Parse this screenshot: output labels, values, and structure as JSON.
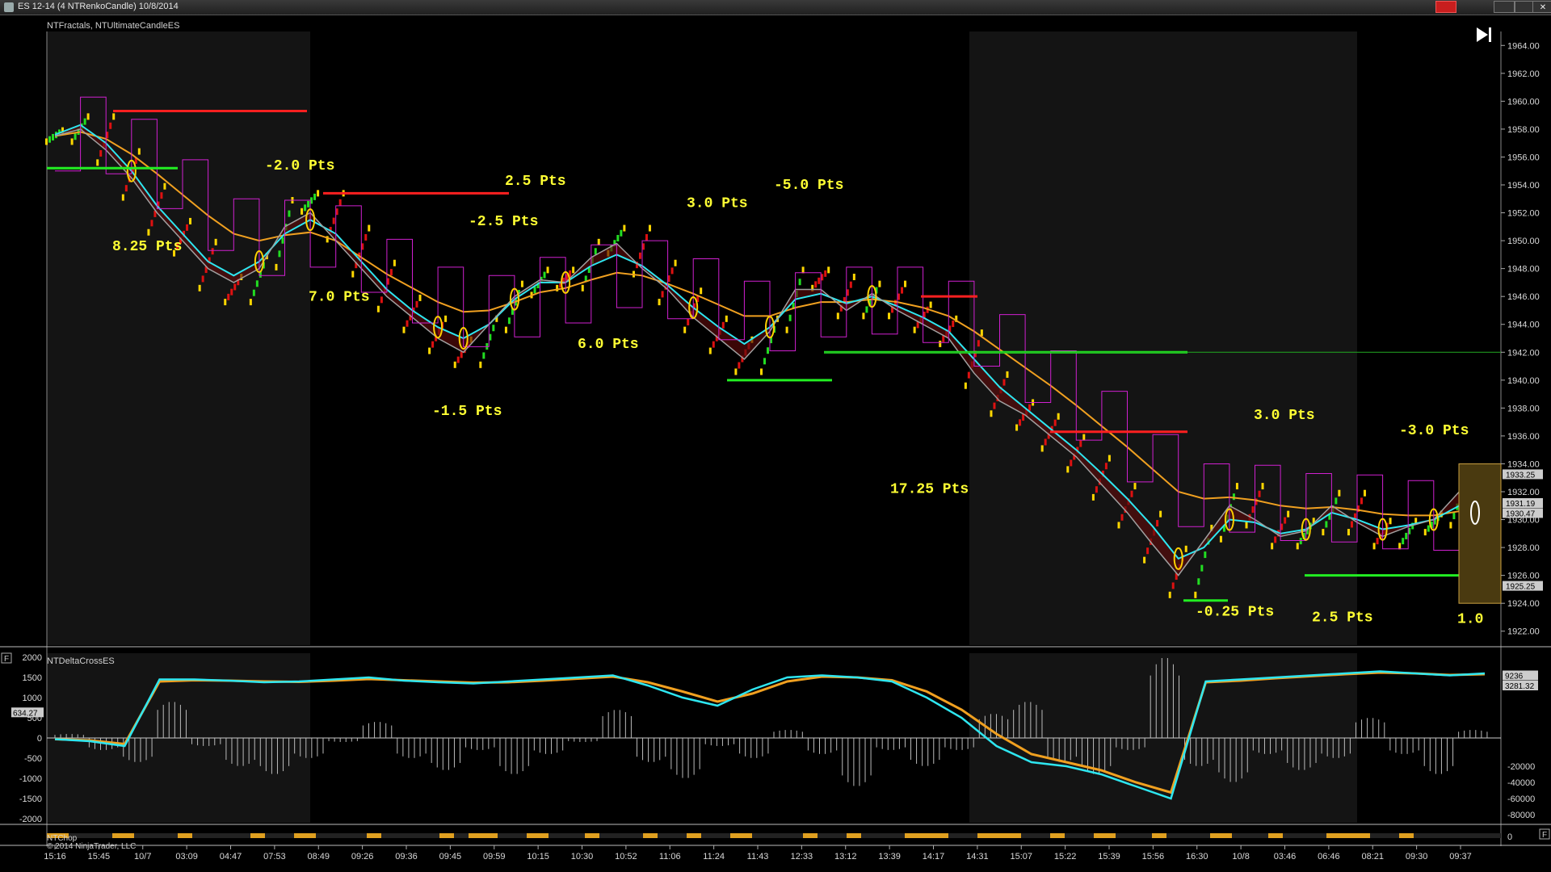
{
  "window": {
    "title": "ES 12-14 (4 NTRenkoCandle)  10/8/2014",
    "icons": [
      "app-icon",
      "close-icon",
      "maximize-icon",
      "minimize-icon",
      "x-icon"
    ],
    "btn_close": "",
    "btn_max": "",
    "btn_min": "",
    "btn_x": "✕"
  },
  "colors": {
    "background": "#000000",
    "session_shade": "#141414",
    "up_bar": "#22dd22",
    "down_bar": "#dd1111",
    "neutral_bar": "#ffd700",
    "cyan_line": "#2ee6f0",
    "orange_line": "#f0a020",
    "gray_line": "#a0a0a0",
    "magenta_line": "#d020d0",
    "label_yellow": "#ffff33",
    "grid_text": "#d8d8d8",
    "chop_bar": "#e0a020"
  },
  "main_panel": {
    "indicator_label": "NTFractals, NTUltimateCandleES",
    "skip_icon": "skip-to-end-icon"
  },
  "lower_panel": {
    "indicator_label": "NTDeltaCrossES",
    "f_icon_left": "F",
    "f_icon_right": "F"
  },
  "chop_panel": {
    "label": "NTChop",
    "copyright": "© 2014 NinjaTrader, LLC"
  },
  "chart_data": {
    "type": "line",
    "main_axis": {
      "ticks": [
        "1964.00",
        "1962.00",
        "1960.00",
        "1958.00",
        "1956.00",
        "1954.00",
        "1952.00",
        "1950.00",
        "1948.00",
        "1946.00",
        "1944.00",
        "1942.00",
        "1940.00",
        "1938.00",
        "1936.00",
        "1934.00",
        "1932.00",
        "1930.00",
        "1928.00",
        "1926.00",
        "1924.00",
        "1922.00"
      ],
      "ylim": [
        1921,
        1965
      ],
      "price_markers": [
        "1933.25",
        "1931.19",
        "1930.47",
        "1925.25"
      ]
    },
    "lower_left_axis": {
      "ticks": [
        "2000",
        "1500",
        "1000",
        "500",
        "0",
        "-500",
        "-1000",
        "-1500",
        "-2000"
      ],
      "ylim": [
        -2100,
        2100
      ],
      "marker": "634.27"
    },
    "lower_right_axis": {
      "ticks": [
        "-20000",
        "-40000",
        "-60000",
        "-80000"
      ],
      "markers": [
        "9236",
        "3281.32"
      ]
    },
    "chop_axis": {
      "ticks": [
        "0"
      ]
    },
    "x_labels": [
      "15:16",
      "15:45",
      "10/7",
      "03:09",
      "04:47",
      "07:53",
      "08:49",
      "09:26",
      "09:36",
      "09:45",
      "09:59",
      "10:15",
      "10:30",
      "10:52",
      "11:06",
      "11:24",
      "11:43",
      "12:33",
      "13:12",
      "13:39",
      "14:17",
      "14:31",
      "15:07",
      "15:22",
      "15:39",
      "15:56",
      "16:30",
      "10/8",
      "03:46",
      "06:46",
      "08:21",
      "09:30",
      "09:37"
    ],
    "trade_labels": [
      {
        "text": "-2.0 Pts",
        "x": 15,
        "y": 1955.1
      },
      {
        "text": "8.25 Pts",
        "x": 4.5,
        "y": 1949.3
      },
      {
        "text": "7.0 Pts",
        "x": 18,
        "y": 1945.7
      },
      {
        "text": "-1.5 Pts",
        "x": 26.5,
        "y": 1937.5
      },
      {
        "text": "-2.5 Pts",
        "x": 29,
        "y": 1951.1
      },
      {
        "text": "2.5 Pts",
        "x": 31.5,
        "y": 1954.0
      },
      {
        "text": "6.0 Pts",
        "x": 36.5,
        "y": 1942.3
      },
      {
        "text": "3.0 Pts",
        "x": 44,
        "y": 1952.4
      },
      {
        "text": "-5.0 Pts",
        "x": 50,
        "y": 1953.7
      },
      {
        "text": "17.25 Pts",
        "x": 58,
        "y": 1931.9
      },
      {
        "text": "3.0 Pts",
        "x": 83,
        "y": 1937.2
      },
      {
        "text": "-3.0 Pts",
        "x": 93,
        "y": 1936.1
      },
      {
        "text": "-0.25 Pts",
        "x": 79,
        "y": 1923.1
      },
      {
        "text": "2.5 Pts",
        "x": 87,
        "y": 1922.7
      },
      {
        "text": "1.0",
        "x": 97,
        "y": 1922.6
      }
    ],
    "series": [
      {
        "values": [
          1957.5,
          1958.5,
          1956,
          1953.5,
          1951,
          1949.5,
          1947,
          1946,
          1948.5,
          1952.5,
          1953,
          1950.5,
          1948,
          1945.5,
          1944,
          1942.5,
          1941.5,
          1944,
          1946.5,
          1947.5,
          1947,
          1949.5,
          1950.5,
          1948,
          1946,
          1944,
          1942.5,
          1941,
          1944,
          1947.5,
          1947,
          1945,
          1946.5,
          1945,
          1944,
          1943,
          1940,
          1938,
          1937,
          1935.5,
          1934,
          1932,
          1930,
          1927.5,
          1925,
          1929,
          1932,
          1930,
          1928.5,
          1929.5,
          1931.5,
          1929.5,
          1928.5,
          1929.5,
          1930,
          1932.5,
          1933
        ]
      },
      {
        "values": [
          1957.6,
          1958.3,
          1957,
          1955,
          1952.5,
          1950.5,
          1948.5,
          1947.5,
          1948.5,
          1950.5,
          1951.5,
          1950.5,
          1948.5,
          1946.5,
          1945,
          1943.8,
          1943,
          1944,
          1945.8,
          1947,
          1947,
          1948.2,
          1949,
          1948.2,
          1946.8,
          1945.2,
          1943.8,
          1942.6,
          1943.8,
          1945.8,
          1946.2,
          1945.5,
          1946,
          1945.3,
          1944.5,
          1943.5,
          1941.5,
          1939.5,
          1938,
          1936.5,
          1935,
          1933.3,
          1931.5,
          1929.5,
          1927.2,
          1928,
          1930,
          1929.8,
          1929,
          1929.3,
          1930.5,
          1930,
          1929.3,
          1929.6,
          1930,
          1931,
          1931.3
        ]
      },
      {
        "values": [
          1957.5,
          1957.8,
          1957.3,
          1956.2,
          1954.8,
          1953.3,
          1951.8,
          1950.5,
          1950,
          1950.4,
          1950.6,
          1950,
          1948.8,
          1947.6,
          1946.6,
          1945.6,
          1944.9,
          1945,
          1945.6,
          1946.3,
          1946.6,
          1947.2,
          1947.7,
          1947.5,
          1946.9,
          1946.2,
          1945.4,
          1944.6,
          1944.6,
          1945.2,
          1945.6,
          1945.6,
          1945.8,
          1945.6,
          1945.2,
          1944.6,
          1943.5,
          1942.2,
          1940.9,
          1939.6,
          1938.2,
          1936.7,
          1935.2,
          1933.6,
          1932,
          1931.5,
          1931.6,
          1931.4,
          1931,
          1930.8,
          1930.9,
          1930.7,
          1930.4,
          1930.3,
          1930.3,
          1930.6,
          1930.8
        ]
      },
      {
        "values": [
          1957.5,
          1958,
          1956.5,
          1954.5,
          1952,
          1950,
          1948,
          1947,
          1948,
          1951,
          1952,
          1950,
          1948,
          1946,
          1944.5,
          1943,
          1942,
          1944,
          1946,
          1947.2,
          1947,
          1948.8,
          1949.8,
          1948,
          1946.5,
          1944.5,
          1943,
          1941.5,
          1943.5,
          1946.5,
          1946.5,
          1945,
          1946.2,
          1945,
          1944,
          1943,
          1940.5,
          1938.5,
          1937.5,
          1936,
          1934.5,
          1932.5,
          1930.5,
          1928.2,
          1926,
          1928.5,
          1931,
          1930,
          1928.8,
          1929.2,
          1931,
          1929.8,
          1928.8,
          1929.5,
          1930,
          1932,
          1932.5
        ]
      }
    ],
    "delta_fast": {
      "values": [
        -30,
        -80,
        -200,
        1450,
        1450,
        1420,
        1380,
        1400,
        1450,
        1500,
        1420,
        1380,
        1350,
        1400,
        1450,
        1500,
        1550,
        1300,
        1000,
        800,
        1200,
        1500,
        1550,
        1500,
        1400,
        1000,
        500,
        -200,
        -600,
        -700,
        -900,
        -1200,
        -1500,
        1400,
        1450,
        1500,
        1550,
        1600,
        1650,
        1600,
        1550,
        1600
      ]
    },
    "delta_slow": {
      "values": [
        -30,
        -60,
        -150,
        1400,
        1430,
        1420,
        1400,
        1390,
        1420,
        1460,
        1430,
        1400,
        1370,
        1380,
        1420,
        1470,
        1520,
        1380,
        1150,
        900,
        1100,
        1400,
        1520,
        1500,
        1430,
        1150,
        700,
        100,
        -400,
        -600,
        -800,
        -1100,
        -1350,
        1380,
        1420,
        1480,
        1530,
        1580,
        1620,
        1600,
        1560,
        1580
      ]
    },
    "delta_histogram": {
      "values": [
        100,
        -300,
        -600,
        900,
        -200,
        -700,
        -900,
        -500,
        -100,
        400,
        -500,
        -800,
        -300,
        -900,
        -400,
        -100,
        700,
        -600,
        -1000,
        -200,
        -500,
        200,
        -400,
        -1200,
        -300,
        -700,
        -300,
        600,
        900,
        -600,
        -900,
        -300,
        2000,
        -700,
        -1100,
        -400,
        -800,
        -500,
        500,
        -400,
        -900,
        200
      ]
    },
    "chop_segments": [
      {
        "start": 0,
        "end": 1.5
      },
      {
        "start": 4.5,
        "end": 6
      },
      {
        "start": 9,
        "end": 10
      },
      {
        "start": 14,
        "end": 15
      },
      {
        "start": 17,
        "end": 18.5
      },
      {
        "start": 22,
        "end": 23
      },
      {
        "start": 27,
        "end": 28
      },
      {
        "start": 29,
        "end": 31
      },
      {
        "start": 33,
        "end": 34.5
      },
      {
        "start": 37,
        "end": 38
      },
      {
        "start": 41,
        "end": 42
      },
      {
        "start": 44,
        "end": 45
      },
      {
        "start": 47,
        "end": 48.5
      },
      {
        "start": 52,
        "end": 53
      },
      {
        "start": 55,
        "end": 56
      },
      {
        "start": 59,
        "end": 62
      },
      {
        "start": 64,
        "end": 67
      },
      {
        "start": 69,
        "end": 70
      },
      {
        "start": 72,
        "end": 73.5
      },
      {
        "start": 76,
        "end": 77
      },
      {
        "start": 80,
        "end": 81.5
      },
      {
        "start": 84,
        "end": 85
      },
      {
        "start": 88,
        "end": 91
      },
      {
        "start": 93,
        "end": 94
      }
    ],
    "grid": false,
    "legend": "none"
  }
}
